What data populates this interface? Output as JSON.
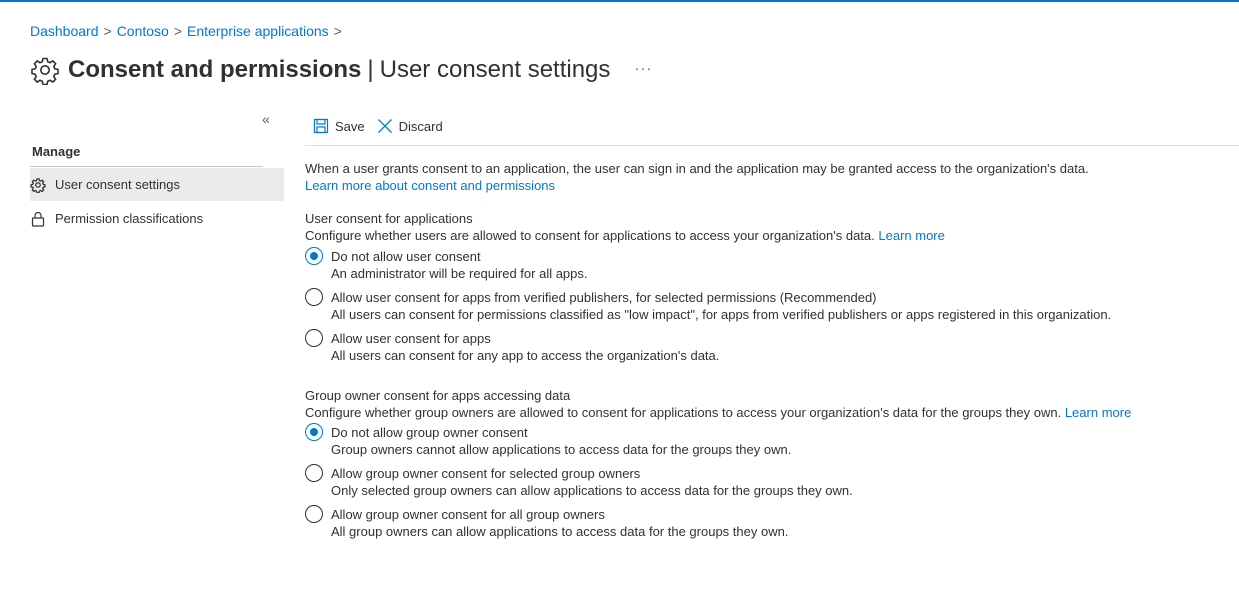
{
  "breadcrumb": {
    "items": [
      "Dashboard",
      "Contoso",
      "Enterprise applications"
    ],
    "separator": ">"
  },
  "header": {
    "title": "Consent and permissions",
    "separator": "|",
    "subtitle": "User consent settings",
    "more": "···",
    "icon": "gear-icon"
  },
  "sidebar": {
    "collapse": "«",
    "heading": "Manage",
    "items": [
      {
        "label": "User consent settings",
        "icon": "gear-icon",
        "selected": true
      },
      {
        "label": "Permission classifications",
        "icon": "lock-icon",
        "selected": false
      }
    ]
  },
  "toolbar": {
    "save_label": "Save",
    "discard_label": "Discard"
  },
  "intro": {
    "text": "When a user grants consent to an application, the user can sign in and the application may be granted access to the organization's data.",
    "link": "Learn more about consent and permissions"
  },
  "user_consent": {
    "title": "User consent for applications",
    "description": "Configure whether users are allowed to consent for applications to access your organization's data.",
    "link": "Learn more",
    "options": [
      {
        "label": "Do not allow user consent",
        "desc": "An administrator will be required for all apps.",
        "checked": true
      },
      {
        "label": "Allow user consent for apps from verified publishers, for selected permissions (Recommended)",
        "desc": "All users can consent for permissions classified as \"low impact\", for apps from verified publishers or apps registered in this organization.",
        "checked": false
      },
      {
        "label": "Allow user consent for apps",
        "desc": "All users can consent for any app to access the organization's data.",
        "checked": false
      }
    ]
  },
  "group_consent": {
    "title": "Group owner consent for apps accessing data",
    "description": "Configure whether group owners are allowed to consent for applications to access your organization's data for the groups they own.",
    "link": "Learn more",
    "options": [
      {
        "label": "Do not allow group owner consent",
        "desc": "Group owners cannot allow applications to access data for the groups they own.",
        "checked": true
      },
      {
        "label": "Allow group owner consent for selected group owners",
        "desc": "Only selected group owners can allow applications to access data for the groups they own.",
        "checked": false
      },
      {
        "label": "Allow group owner consent for all group owners",
        "desc": "All group owners can allow applications to access data for the groups they own.",
        "checked": false
      }
    ]
  },
  "colors": {
    "accent": "#0078d4",
    "text": "#323130",
    "selected_bg": "#edebe9"
  }
}
